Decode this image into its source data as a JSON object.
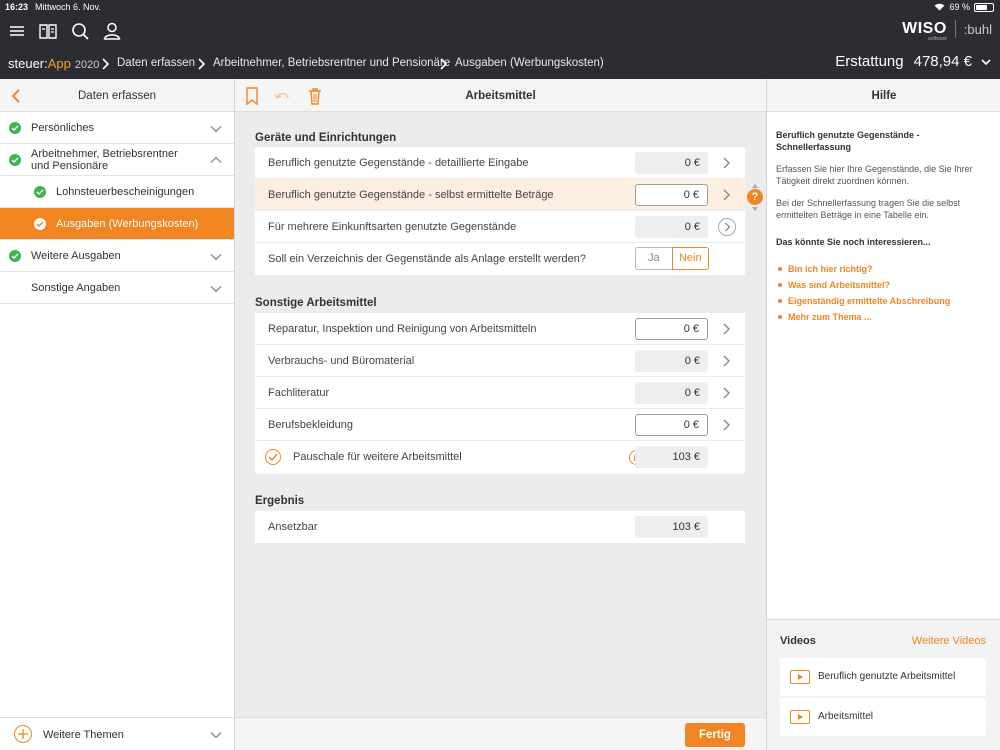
{
  "status": {
    "time": "16:23",
    "date": "Mittwoch 6. Nov.",
    "battery": "69 %",
    "battery_level": 0.69
  },
  "header": {
    "brand": "WISO",
    "brand_sub": "software",
    "buhl": ":buhl",
    "app_prefix": "steuer:",
    "app_name": "App",
    "app_year": "2020",
    "breadcrumbs": [
      "Daten erfassen",
      "Arbeitnehmer, Betriebsrentner und Pensionäre",
      "Ausgaben (Werbungskosten)"
    ],
    "refund_label": "Erstattung",
    "refund_value": "478,94 €"
  },
  "sidebar": {
    "title": "Daten erfassen",
    "items": [
      {
        "label": "Persönliches"
      },
      {
        "label": "Arbeitnehmer, Betriebsrentner",
        "label2": "und Pensionäre"
      },
      {
        "label": "Lohnsteuerbescheinigungen"
      },
      {
        "label": "Ausgaben (Werbungskosten)"
      },
      {
        "label": "Weitere Ausgaben"
      },
      {
        "label": "Sonstige Angaben"
      }
    ],
    "footer": "Weitere Themen"
  },
  "main": {
    "title": "Arbeitsmittel",
    "sections": [
      {
        "title": "Geräte und Einrichtungen",
        "rows": [
          {
            "label": "Beruflich genutzte Gegenstände - detaillierte Eingabe",
            "value": "0 €"
          },
          {
            "label": "Beruflich genutzte Gegenstände - selbst ermittelte Beträge",
            "value": "0 €"
          },
          {
            "label": "Für mehrere Einkunftsarten genutzte Gegenstände",
            "value": "0 €"
          },
          {
            "label": "Soll ein Verzeichnis der Gegenstände als Anlage erstellt werden?",
            "yes": "Ja",
            "no": "Nein"
          }
        ]
      },
      {
        "title": "Sonstige Arbeitsmittel",
        "rows": [
          {
            "label": "Reparatur, Inspektion und Reinigung von Arbeitsmitteln",
            "value": "0 €"
          },
          {
            "label": "Verbrauchs- und Büromaterial",
            "value": "0 €"
          },
          {
            "label": "Fachliteratur",
            "value": "0 €"
          },
          {
            "label": "Berufsbekleidung",
            "value": "0 €"
          },
          {
            "label": "Pauschale für weitere Arbeitsmittel",
            "value": "103 €"
          }
        ]
      },
      {
        "title": "Ergebnis",
        "rows": [
          {
            "label": "Ansetzbar",
            "value": "103 €"
          }
        ]
      }
    ],
    "help_q": "?",
    "done": "Fertig"
  },
  "help": {
    "title": "Hilfe",
    "heading": "Beruflich genutzte Gegenstände - Schnellerfassung",
    "p1": "Erfassen Sie hier Ihre Gegenstände, die Sie Ihrer Tätigkeit direkt zuordnen können.",
    "p2": "Bei der Schnellerfassung tragen Sie die selbst ermittelten Beträge in eine Tabelle ein.",
    "more": "Das könnte Sie noch interessieren...",
    "links": [
      "Bin ich hier richtig?",
      "Was sind Arbeitsmittel?",
      "Eigenständig ermittelte Abschreibung",
      "Mehr zum Thema ..."
    ],
    "videos_title": "Videos",
    "videos_more": "Weitere Videos",
    "videos": [
      "Beruflich genutzte Arbeitsmittel",
      "Arbeitsmittel"
    ]
  },
  "colors": {
    "accent": "#f08522",
    "success": "#3fb44a",
    "header_bg": "#2b2d33"
  }
}
